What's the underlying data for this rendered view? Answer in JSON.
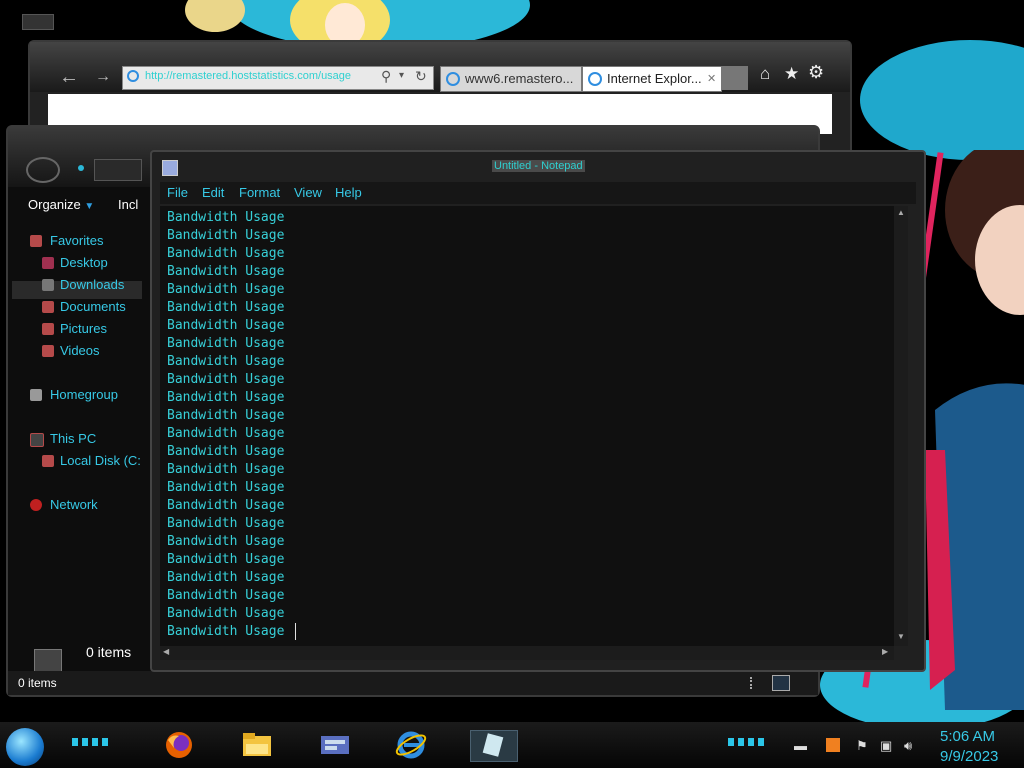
{
  "browser": {
    "address_url": "http://remastered.hoststatistics.com/usage",
    "tabs": [
      {
        "label": "www6.remastero..."
      },
      {
        "label": "Internet Explor..."
      }
    ],
    "tab_close": "✕",
    "icons": [
      "back-arrow-icon",
      "forward-arrow-icon",
      "search-icon",
      "refresh-icon",
      "home-icon",
      "favorites-star-icon",
      "settings-gear-icon"
    ]
  },
  "explorer": {
    "toolbar": {
      "organize": "Organize",
      "include": "Incl"
    },
    "nav": [
      {
        "label": "Favorites",
        "icon": "star-icon"
      },
      {
        "label": "Desktop",
        "icon": "desktop-icon"
      },
      {
        "label": "Downloads",
        "icon": "downloads-icon"
      },
      {
        "label": "Documents",
        "icon": "documents-icon"
      },
      {
        "label": "Pictures",
        "icon": "pictures-icon"
      },
      {
        "label": "Videos",
        "icon": "videos-icon"
      },
      {
        "label": "Homegroup",
        "icon": "homegroup-icon"
      },
      {
        "label": "This PC",
        "icon": "computer-icon"
      },
      {
        "label": "Local Disk (C:",
        "icon": "disk-icon"
      },
      {
        "label": "Network",
        "icon": "network-icon"
      }
    ],
    "details_count": "0 items",
    "status_count": "0 items"
  },
  "notepad": {
    "title": "Untitled - Notepad",
    "menu": [
      "File",
      "Edit",
      "Format",
      "View",
      "Help"
    ],
    "lines": [
      "Bandwidth Usage",
      "Bandwidth Usage",
      "Bandwidth Usage",
      "Bandwidth Usage",
      "Bandwidth Usage",
      "Bandwidth Usage",
      "Bandwidth Usage",
      "Bandwidth Usage",
      "Bandwidth Usage",
      "Bandwidth Usage",
      "Bandwidth Usage",
      "Bandwidth Usage",
      "Bandwidth Usage",
      "Bandwidth Usage",
      "Bandwidth Usage",
      "Bandwidth Usage",
      "Bandwidth Usage",
      "Bandwidth Usage",
      "Bandwidth Usage",
      "Bandwidth Usage",
      "Bandwidth Usage",
      "Bandwidth Usage",
      "Bandwidth Usage",
      "Bandwidth Usage "
    ]
  },
  "taskbar": {
    "pinned": [
      "firefox-icon",
      "file-explorer-icon",
      "control-panel-icon",
      "internet-explorer-icon",
      "notepad-icon"
    ],
    "clock_time": "5:06 AM",
    "clock_date": "9/9/2023"
  },
  "colors": {
    "accent": "#37c9e6",
    "text_cyan": "#37d0d8",
    "wallpaper_blue": "#2bb8d8",
    "wallpaper_pink": "#e0245e"
  }
}
